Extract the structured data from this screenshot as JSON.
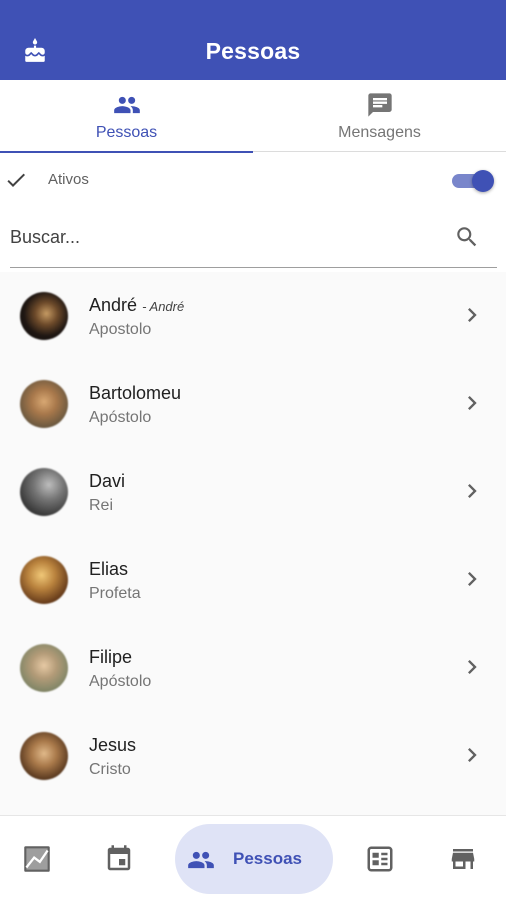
{
  "appbar": {
    "title": "Pessoas",
    "icon": "cake-icon"
  },
  "tabs": [
    {
      "label": "Pessoas",
      "icon": "people-icon",
      "active": true
    },
    {
      "label": "Mensagens",
      "icon": "message-icon",
      "active": false
    }
  ],
  "filter": {
    "label": "Ativos",
    "toggle_on": true
  },
  "search": {
    "placeholder": "Buscar...",
    "value": ""
  },
  "people": [
    {
      "name": "André",
      "alias": "André",
      "role": "Apostolo"
    },
    {
      "name": "Bartolomeu",
      "alias": "",
      "role": "Apóstolo"
    },
    {
      "name": "Davi",
      "alias": "",
      "role": "Rei"
    },
    {
      "name": "Elias",
      "alias": "",
      "role": "Profeta"
    },
    {
      "name": "Filipe",
      "alias": "",
      "role": "Apóstolo"
    },
    {
      "name": "Jesus",
      "alias": "",
      "role": "Cristo"
    }
  ],
  "bottom_nav": {
    "items": [
      "chart-icon",
      "calendar-icon",
      "people-icon",
      "calendar-view-icon",
      "store-icon"
    ],
    "active_label": "Pessoas"
  },
  "colors": {
    "primary": "#3f51b5",
    "toggle_track": "#7986cb",
    "active_pill": "#dfe3f6"
  }
}
